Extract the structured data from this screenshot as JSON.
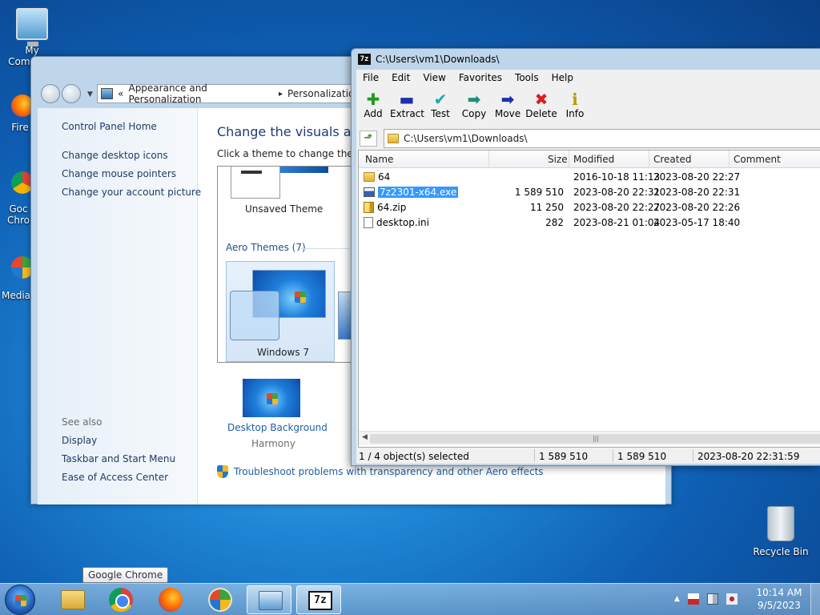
{
  "desktop": {
    "icons": [
      {
        "label": "My Computer"
      },
      {
        "label": "Fire"
      },
      {
        "label": "Goc Chro"
      },
      {
        "label": "Media"
      },
      {
        "label": "Recycle Bin"
      }
    ]
  },
  "control_panel": {
    "breadcrumb": {
      "sep": "«",
      "item1": "Appearance and Personalization",
      "arrow": "▸",
      "item2": "Personalization"
    },
    "sidebar": {
      "home": "Control Panel Home",
      "links": [
        "Change desktop icons",
        "Change mouse pointers",
        "Change your account picture"
      ],
      "see_also_label": "See also",
      "see_also": [
        "Display",
        "Taskbar and Start Menu",
        "Ease of Access Center"
      ]
    },
    "title": "Change the visuals and s",
    "subtitle": "Click a theme to change the des",
    "themes": {
      "unsaved": "Unsaved Theme",
      "aero_header": "Aero Themes (7)",
      "windows7": "Windows 7"
    },
    "background": {
      "label": "Desktop Background",
      "value": "Harmony"
    },
    "troubleshoot": "Troubleshoot problems with transparency and other Aero effects"
  },
  "zip": {
    "title": "C:\\Users\\vm1\\Downloads\\",
    "menu": [
      "File",
      "Edit",
      "View",
      "Favorites",
      "Tools",
      "Help"
    ],
    "toolbar": [
      {
        "label": "Add",
        "glyph": "✚",
        "color": "#1e9e1e"
      },
      {
        "label": "Extract",
        "glyph": "▬",
        "color": "#1c2fb0"
      },
      {
        "label": "Test",
        "glyph": "✔",
        "color": "#1aa9a9"
      },
      {
        "label": "Copy",
        "glyph": "➡",
        "color": "#1d8f7a"
      },
      {
        "label": "Move",
        "glyph": "➡",
        "color": "#1c2fb0"
      },
      {
        "label": "Delete",
        "glyph": "✖",
        "color": "#d81e1e"
      },
      {
        "label": "Info",
        "glyph": "ℹ",
        "color": "#b59a00"
      }
    ],
    "path": "C:\\Users\\vm1\\Downloads\\",
    "columns": {
      "name": "Name",
      "size": "Size",
      "modified": "Modified",
      "created": "Created",
      "comment": "Comment"
    },
    "rows": [
      {
        "name": "64",
        "size": "",
        "modified": "2016-10-18 11:13",
        "created": "2023-08-20 22:27",
        "type": "folder"
      },
      {
        "name": "7z2301-x64.exe",
        "size": "1 589 510",
        "modified": "2023-08-20 22:31",
        "created": "2023-08-20 22:31",
        "type": "exe",
        "selected": true
      },
      {
        "name": "64.zip",
        "size": "11 250",
        "modified": "2023-08-20 22:27",
        "created": "2023-08-20 22:26",
        "type": "zip"
      },
      {
        "name": "desktop.ini",
        "size": "282",
        "modified": "2023-08-21 01:04",
        "created": "2023-05-17 18:40",
        "type": "ini"
      }
    ],
    "status": {
      "selected": "1 / 4 object(s) selected",
      "size": "1 589 510",
      "packed": "1 589 510",
      "date": "2023-08-20 22:31:59"
    }
  },
  "taskbar": {
    "tooltip": "Google Chrome",
    "clock_time": "10:14 AM",
    "clock_date": "9/5/2023",
    "z7_label": "7z"
  }
}
